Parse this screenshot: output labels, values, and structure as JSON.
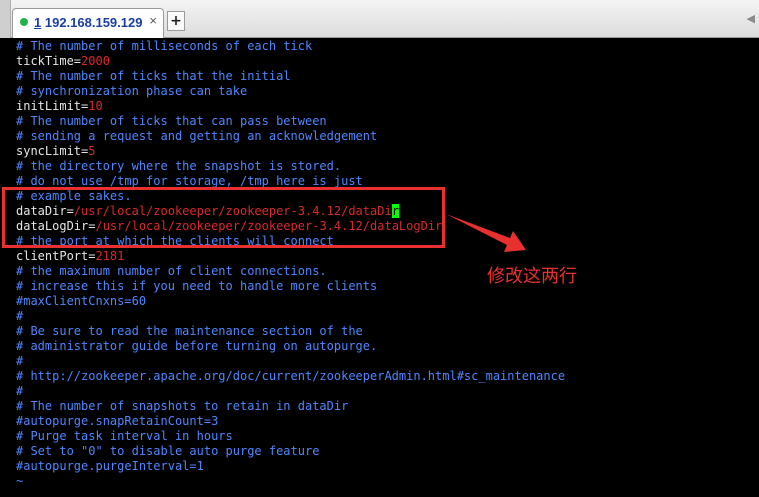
{
  "window": {
    "tab": {
      "index": "1",
      "title": "192.168.159.129",
      "close_glyph": "×"
    },
    "new_tab_glyph": "+",
    "scroll_glyph": "◀"
  },
  "terminal": {
    "lines": [
      {
        "type": "comment",
        "text": "# The number of milliseconds of each tick"
      },
      {
        "type": "kv",
        "key": "tickTime=",
        "value": "2000"
      },
      {
        "type": "comment",
        "text": "# The number of ticks that the initial"
      },
      {
        "type": "comment",
        "text": "# synchronization phase can take"
      },
      {
        "type": "kv",
        "key": "initLimit=",
        "value": "10"
      },
      {
        "type": "comment",
        "text": "# The number of ticks that can pass between"
      },
      {
        "type": "comment",
        "text": "# sending a request and getting an acknowledgement"
      },
      {
        "type": "kv",
        "key": "syncLimit=",
        "value": "5"
      },
      {
        "type": "comment",
        "text": "# the directory where the snapshot is stored."
      },
      {
        "type": "comment",
        "text": "# do not use /tmp for storage, /tmp here is just"
      },
      {
        "type": "comment",
        "text": "# example sakes."
      },
      {
        "type": "kv_cursor",
        "key": "dataDir=",
        "value": "/usr/local/zookeeper/zookeeper-3.4.12/dataDi",
        "cursor": "r"
      },
      {
        "type": "kv",
        "key": "dataLogDir=",
        "value": "/usr/local/zookeeper/zookeeper-3.4.12/dataLogDir"
      },
      {
        "type": "comment",
        "text": "# the port at which the clients will connect"
      },
      {
        "type": "kv",
        "key": "clientPort=",
        "value": "2181"
      },
      {
        "type": "comment",
        "text": "# the maximum number of client connections."
      },
      {
        "type": "comment",
        "text": "# increase this if you need to handle more clients"
      },
      {
        "type": "comment",
        "text": "#maxClientCnxns=60"
      },
      {
        "type": "comment",
        "text": "#"
      },
      {
        "type": "comment",
        "text": "# Be sure to read the maintenance section of the"
      },
      {
        "type": "comment",
        "text": "# administrator guide before turning on autopurge."
      },
      {
        "type": "comment",
        "text": "#"
      },
      {
        "type": "comment",
        "text": "# http://zookeeper.apache.org/doc/current/zookeeperAdmin.html#sc_maintenance"
      },
      {
        "type": "comment",
        "text": "#"
      },
      {
        "type": "comment",
        "text": "# The number of snapshots to retain in dataDir"
      },
      {
        "type": "comment",
        "text": "#autopurge.snapRetainCount=3"
      },
      {
        "type": "comment",
        "text": "# Purge task interval in hours"
      },
      {
        "type": "comment",
        "text": "# Set to \"0\" to disable auto purge feature"
      },
      {
        "type": "comment",
        "text": "#autopurge.purgeInterval=1"
      },
      {
        "type": "tilde",
        "text": "~"
      }
    ]
  },
  "annotation": {
    "text": "修改这两行",
    "color": "#e8312f"
  },
  "colors": {
    "comment": "#4f86ff",
    "value": "#d92a2a",
    "cursor": "#00ff00",
    "tab_title": "#1a3ea6",
    "status_dot": "#23b14d"
  },
  "icons": {
    "status": "connection-status-dot-icon",
    "close": "close-icon",
    "new_tab": "plus-icon",
    "scroll": "chevron-left-icon",
    "arrow": "arrow-icon"
  }
}
